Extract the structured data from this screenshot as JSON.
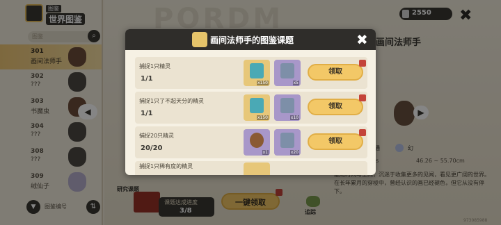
{
  "sidebar": {
    "header_small": "图鉴",
    "header_big": "世界图鉴",
    "search_placeholder": "图鉴",
    "items": [
      {
        "num": "301",
        "name": "画间法师手"
      },
      {
        "num": "302",
        "name": "???"
      },
      {
        "num": "303",
        "name": "书魔虫"
      },
      {
        "num": "304",
        "name": "???"
      },
      {
        "num": "308",
        "name": "???"
      },
      {
        "num": "309",
        "name": "绒仙子"
      }
    ],
    "sort_label": "图鉴编号"
  },
  "currency": {
    "value": "2550"
  },
  "detail": {
    "title": "画间法师手",
    "rarity": "普通",
    "element": "幻",
    "stat_left": "34s",
    "stat_range": "46.26 ~ 55.70cm",
    "description": "能随时间与空间，沉迷于收集更多的见闻，看见更广阔的世界。在长年累月的穿梭中，曾经认识的画已经褪色，但它从没有停下。"
  },
  "bottom": {
    "research_label": "研究课题",
    "progress_label": "课题达成进度",
    "progress_value": "3/8",
    "oneclick_label": "一键领取",
    "track_label": "追踪"
  },
  "uid": "973085988",
  "modal": {
    "title": "画间法师手的图鉴课题",
    "claim_label": "领取",
    "tasks": [
      {
        "name": "捕捉1只精灵",
        "progress": "1/1",
        "rewards": [
          {
            "qty": "x150"
          },
          {
            "qty": "x5"
          }
        ]
      },
      {
        "name": "捕捉1只了不起天分的精灵",
        "progress": "1/1",
        "rewards": [
          {
            "qty": "x150"
          },
          {
            "qty": "x10"
          }
        ]
      },
      {
        "name": "捕捉20只精灵",
        "progress": "20/20",
        "rewards": [
          {
            "qty": "x1"
          },
          {
            "qty": "x20"
          }
        ]
      },
      {
        "name": "捕捉1只稀有度的精灵",
        "progress": "",
        "rewards": []
      }
    ]
  }
}
